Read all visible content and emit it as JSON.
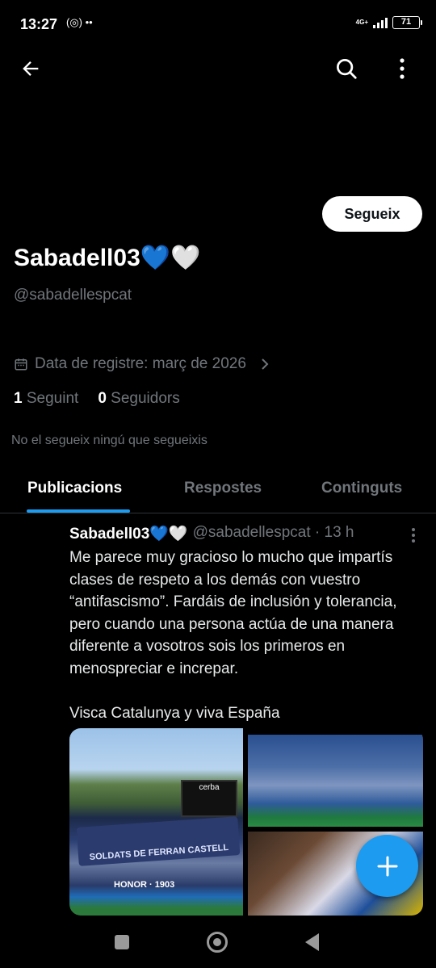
{
  "status_bar": {
    "time": "13:27",
    "left_icons": "(◎) ••",
    "network": "4G+",
    "battery": "71"
  },
  "header": {
    "back_icon": "arrow-left-icon",
    "search_icon": "search-icon",
    "more_icon": "more-vertical-icon"
  },
  "profile": {
    "follow_label": "Segueix",
    "display_name": "Sabadell03💙🤍",
    "handle": "@sabadellespcat",
    "join_date": "Data de registre: març de 2026",
    "following_count": "1",
    "following_label": "Seguint",
    "followers_count": "0",
    "followers_label": "Seguidors",
    "follow_note": "No el segueix ningú que segueixis"
  },
  "tabs": [
    {
      "label": "Publicacions",
      "active": true
    },
    {
      "label": "Respostes",
      "active": false
    },
    {
      "label": "Continguts",
      "active": false
    }
  ],
  "post": {
    "author": "Sabadell03💙🤍",
    "handle_time": "@sabadellespcat · 13 h",
    "text": "Me parece muy gracioso lo mucho que impartís clases de respeto a los demás con vuestro “antifascismo”. Fardáis de inclusión y tolerancia, pero cuando una persona actúa de una manera diferente a vosotros sois los primeros en menospreciar e increpar.\n\nVisca Catalunya y viva España",
    "media": {
      "banner_text": "SOLDATS DE FERRAN CASTELL",
      "scoreboard": "cerba",
      "honor_text": "HONOR · 1903"
    }
  },
  "fab": {
    "icon": "plus-icon"
  },
  "nav": {
    "recents": "square-icon",
    "home": "circle-icon",
    "back": "triangle-back-icon"
  }
}
